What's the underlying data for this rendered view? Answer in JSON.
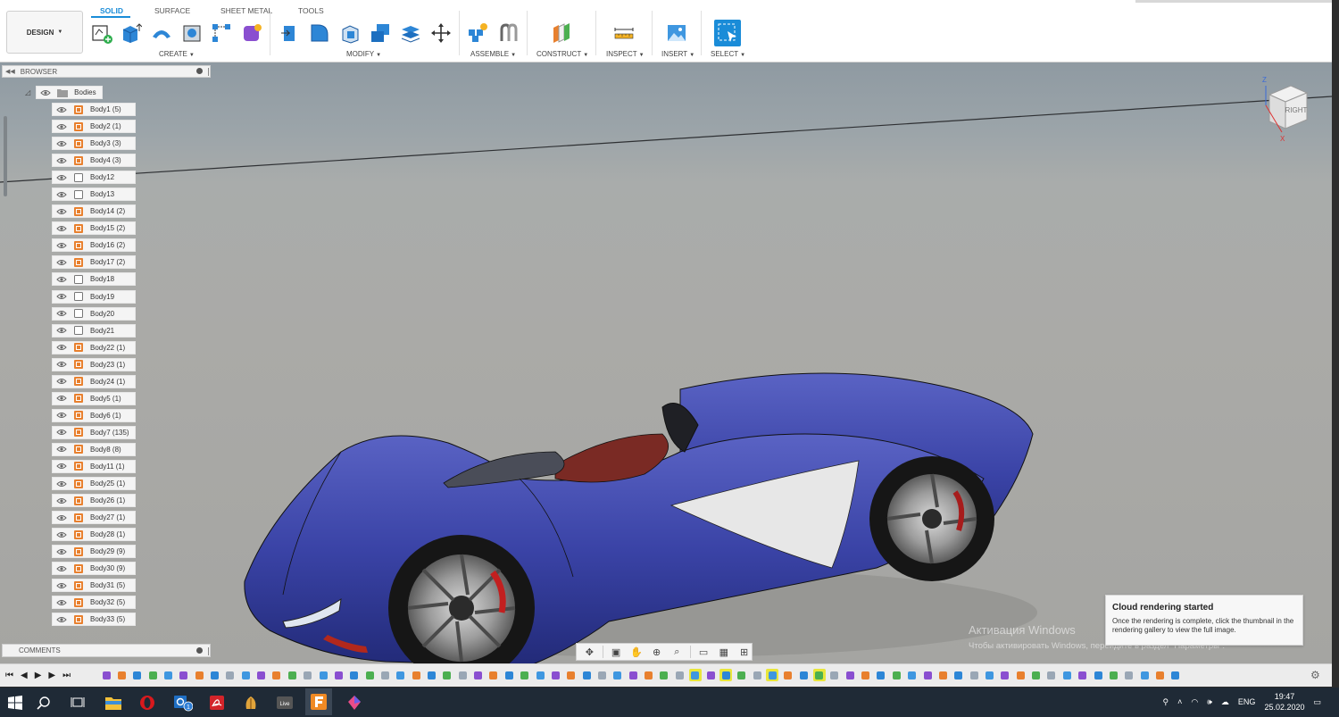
{
  "workspace": {
    "label": "DESIGN"
  },
  "tabs": [
    {
      "label": "SOLID",
      "active": true
    },
    {
      "label": "SURFACE"
    },
    {
      "label": "SHEET METAL"
    },
    {
      "label": "TOOLS"
    }
  ],
  "groups": {
    "create": "CREATE",
    "modify": "MODIFY",
    "assemble": "ASSEMBLE",
    "construct": "CONSTRUCT",
    "inspect": "INSPECT",
    "insert": "INSERT",
    "select": "SELECT"
  },
  "browser": {
    "title": "BROWSER",
    "folder": "Bodies",
    "bodies": [
      "Body1 (5)",
      "Body2 (1)",
      "Body3 (3)",
      "Body4 (3)",
      "Body12",
      "Body13",
      "Body14 (2)",
      "Body15 (2)",
      "Body16 (2)",
      "Body17 (2)",
      "Body18",
      "Body19",
      "Body20",
      "Body21",
      "Body22 (1)",
      "Body23 (1)",
      "Body24 (1)",
      "Body5 (1)",
      "Body6 (1)",
      "Body7 (135)",
      "Body8 (8)",
      "Body11 (1)",
      "Body25 (1)",
      "Body26 (1)",
      "Body27 (1)",
      "Body28 (1)",
      "Body29 (9)",
      "Body30 (9)",
      "Body31 (5)",
      "Body32 (5)",
      "Body33 (5)"
    ]
  },
  "comments": {
    "title": "COMMENTS"
  },
  "viewcube": {
    "face": "RIGHT",
    "axis_z": "Z",
    "axis_x": "X"
  },
  "toast": {
    "title": "Cloud rendering started",
    "body": "Once the rendering is complete, click the thumbnail in the rendering gallery to view the full image."
  },
  "watermark": {
    "line1": "Активация Windows",
    "line2": "Чтобы активировать Windows, перейдите в раздел \"Параметры\"."
  },
  "taskbar": {
    "lang": "ENG",
    "time": "19:47",
    "date": "25.02.2020",
    "badge": "1"
  },
  "colors": {
    "accent": "#1a8cd8",
    "car_body": "#3a43a6",
    "viewport_bg": "#a9aaa8",
    "taskbar": "#1f2a36"
  }
}
